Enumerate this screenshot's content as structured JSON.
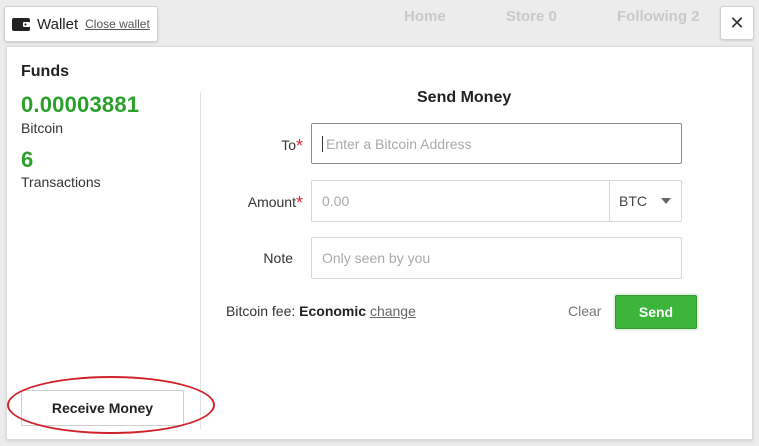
{
  "background_nav": {
    "items": [
      "Home",
      "Store 0",
      "Following 2"
    ]
  },
  "wallet_tab": {
    "title": "Wallet",
    "close_label": "Close wallet",
    "icon": "wallet-icon"
  },
  "close_button": {
    "glyph": "✕",
    "icon": "close-icon"
  },
  "funds": {
    "title": "Funds",
    "balance": "0.00003881",
    "balance_unit": "Bitcoin",
    "transactions_count": "6",
    "transactions_label": "Transactions",
    "receive_label": "Receive Money",
    "highlight_color": "#d0222a",
    "value_color": "#2aa02a"
  },
  "send_money": {
    "title": "Send Money",
    "to_label": "To",
    "to_placeholder": "Enter a Bitcoin Address",
    "amount_label": "Amount",
    "amount_placeholder": "0.00",
    "currency": "BTC",
    "note_label": "Note",
    "note_placeholder": "Only seen by you",
    "required_mark": "*",
    "fee_prefix": "Bitcoin fee:",
    "fee_level": "Economic",
    "fee_change": "change",
    "clear_label": "Clear",
    "send_label": "Send",
    "send_color": "#3cb53a"
  }
}
